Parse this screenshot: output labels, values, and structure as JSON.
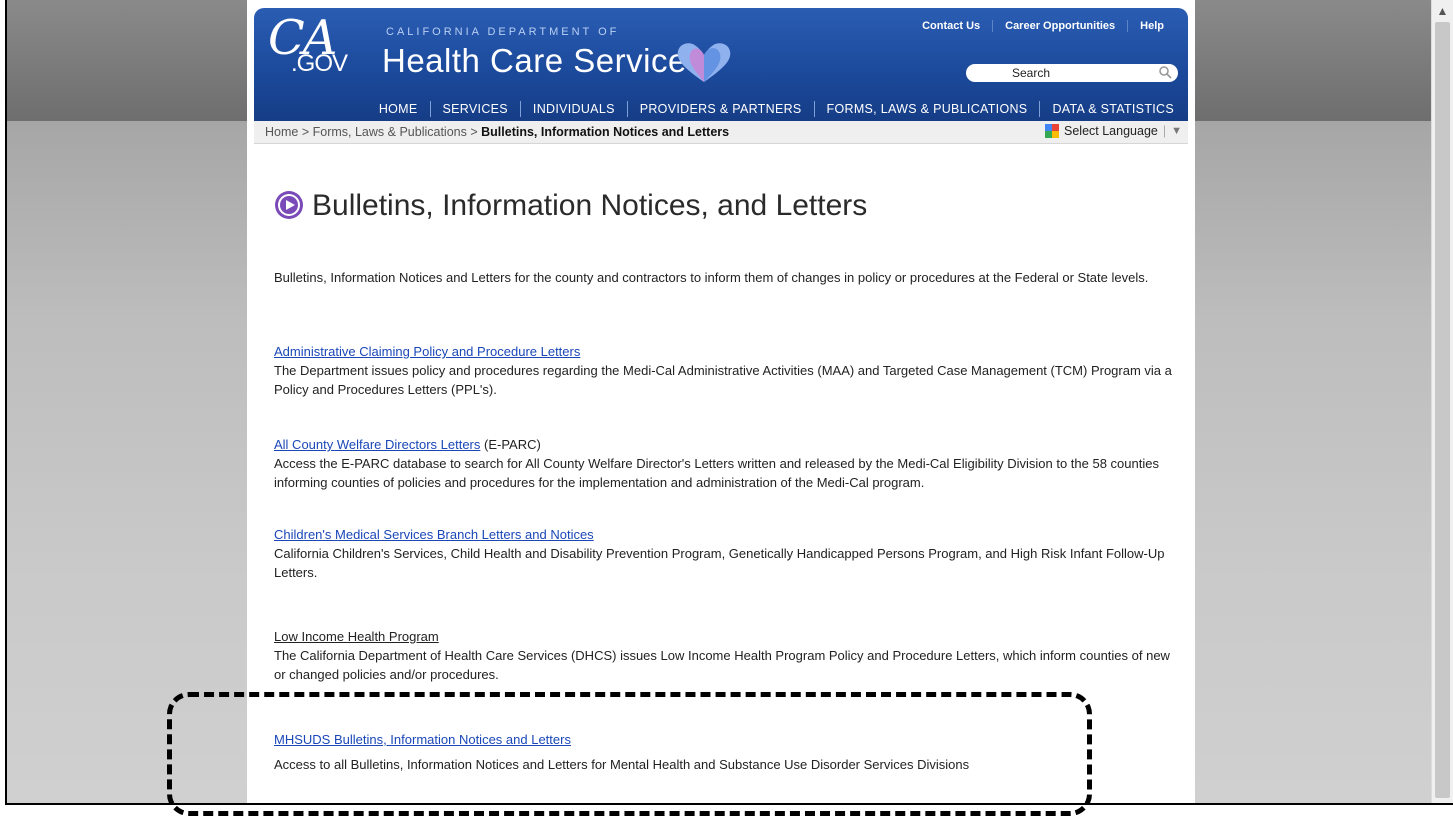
{
  "header": {
    "logo_main": "CA",
    "logo_sub": ".GOV",
    "dept_line": "CALIFORNIA DEPARTMENT OF",
    "dept_name": "Health Care Services",
    "utility_links": [
      "Contact Us",
      "Career Opportunities",
      "Help"
    ],
    "search_placeholder": "Search",
    "nav": [
      "HOME",
      "SERVICES",
      "INDIVIDUALS",
      "PROVIDERS & PARTNERS",
      "FORMS, LAWS & PUBLICATIONS",
      "DATA & STATISTICS"
    ]
  },
  "breadcrumb": {
    "home": "Home",
    "sep": ">",
    "parent": "Forms, Laws & Publications",
    "current": "Bulletins, Information Notices and Letters",
    "translate_label": "Select Language"
  },
  "content": {
    "title": "Bulletins, Information Notices, and Letters",
    "intro": "Bulletins, Information Notices and Letters for the county and contractors to inform them of changes in policy or procedures at the Federal or State levels.",
    "sections": [
      {
        "link": "Administrative Claiming Policy and Procedure Letters ",
        "suffix": "",
        "desc": "The Department issues policy and procedures regarding the Medi-Cal Administrative Activities (MAA) and Targeted Case Management (TCM) Program via a Policy and Procedures Letters (PPL's)."
      },
      {
        "link": "All County Welfare Directors Letters",
        "suffix": " (E-PARC)",
        "desc": "Access the E-PARC database to search for All County Welfare Director's Letters written and released by the Medi-Cal Eligibility Division to the 58 counties informing counties of policies and procedures for the implementation and administration of the Medi-Cal program."
      },
      {
        "link": "Children's Medical Services Branch Letters and Notices",
        "suffix": "",
        "desc": "California Children's Services, Child Health and Disability Prevention Program, Genetically Handicapped Persons Program, and High Risk Infant Follow-Up Letters."
      },
      {
        "link": "Low Income Health Program",
        "suffix": "",
        "desc": "The California Department of Health Care Services (DHCS) issues Low Income Health Program Policy and Procedure Letters, which inform counties of new or changed policies and/or procedures."
      },
      {
        "link": "MHSUDS Bulletins, Information Notices and Letters",
        "suffix": "",
        "desc": "Access to all Bulletins, Information Notices and Letters for Mental Health and Substance Use Disorder Services Divisions"
      }
    ]
  }
}
